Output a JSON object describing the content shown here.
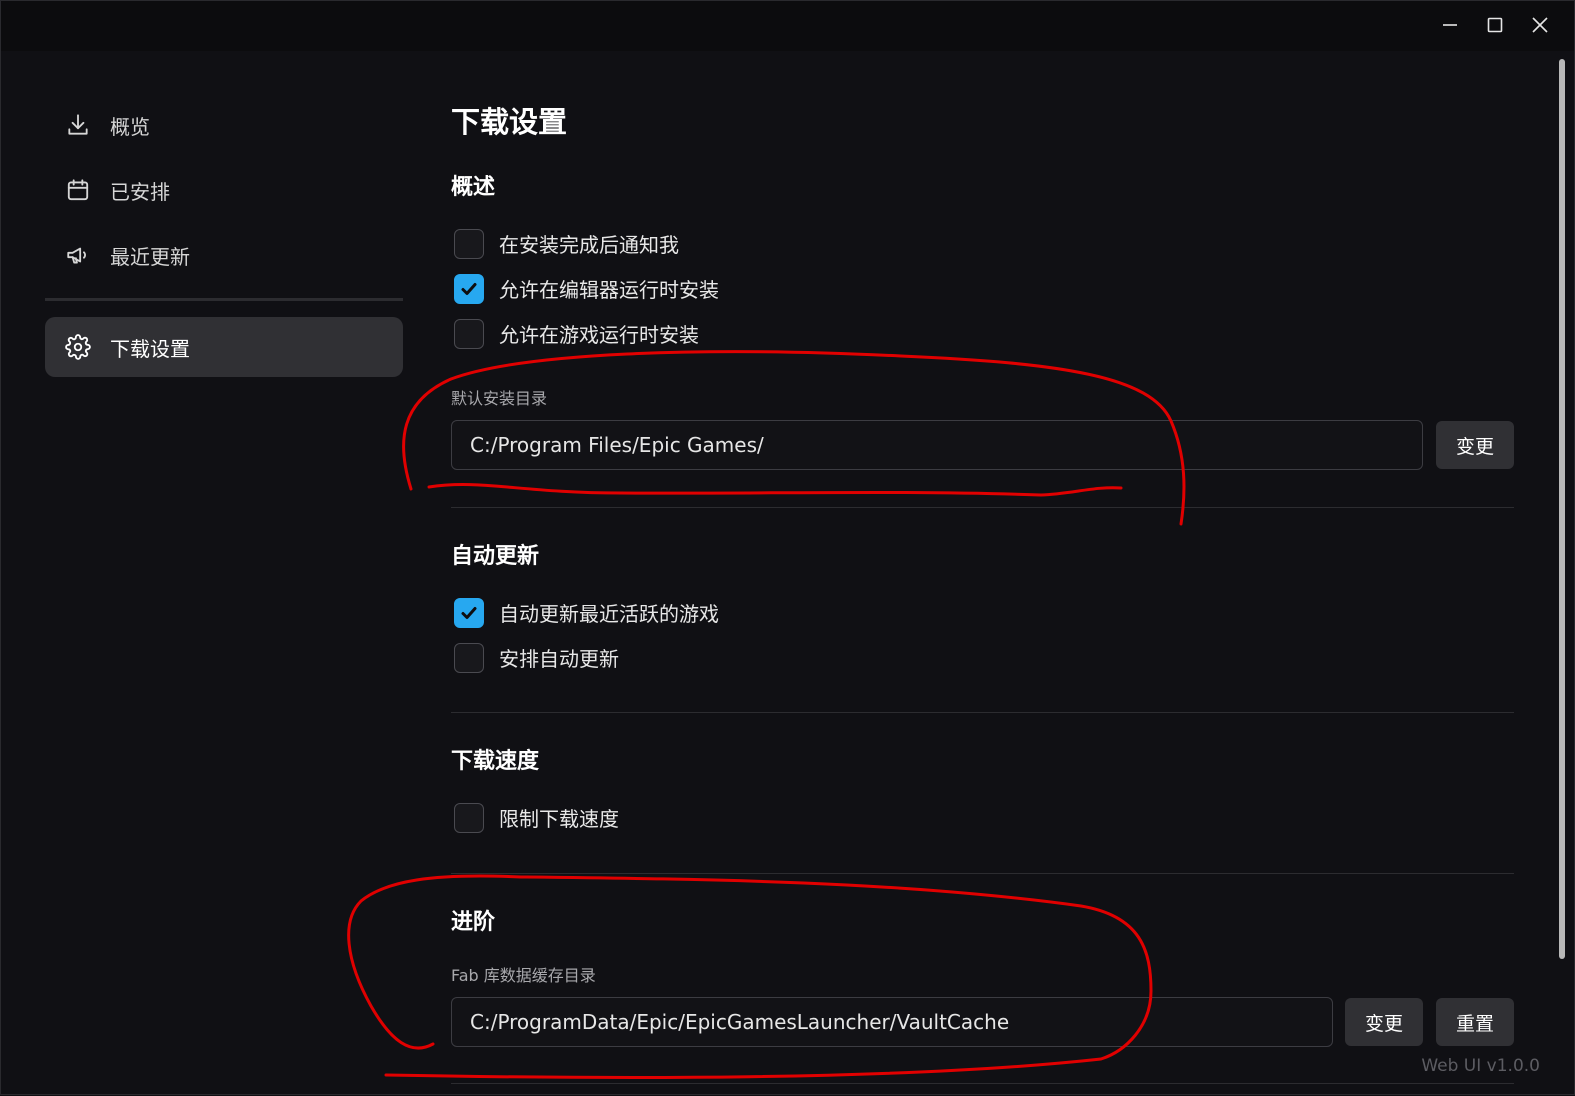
{
  "window": {
    "controls": [
      "minimize",
      "maximize",
      "close"
    ]
  },
  "sidebar": {
    "items": [
      {
        "label": "概览",
        "icon": "download-icon",
        "active": false
      },
      {
        "label": "已安排",
        "icon": "calendar-icon",
        "active": false
      },
      {
        "label": "最近更新",
        "icon": "megaphone-icon",
        "active": false
      },
      {
        "label": "下载设置",
        "icon": "gear-icon",
        "active": true
      }
    ]
  },
  "main": {
    "title": "下载设置",
    "overview": {
      "title": "概述",
      "options": [
        {
          "label": "在安装完成后通知我",
          "checked": false
        },
        {
          "label": "允许在编辑器运行时安装",
          "checked": true
        },
        {
          "label": "允许在游戏运行时安装",
          "checked": false
        }
      ],
      "install_dir_label": "默认安装目录",
      "install_dir_value": "C:/Program Files/Epic Games/",
      "change_button": "变更"
    },
    "auto_update": {
      "title": "自动更新",
      "options": [
        {
          "label": "自动更新最近活跃的游戏",
          "checked": true
        },
        {
          "label": "安排自动更新",
          "checked": false
        }
      ]
    },
    "download_speed": {
      "title": "下载速度",
      "options": [
        {
          "label": "限制下载速度",
          "checked": false
        }
      ]
    },
    "advanced": {
      "title": "进阶",
      "cache_dir_label": "Fab 库数据缓存目录",
      "cache_dir_value": "C:/ProgramData/Epic/EpicGamesLauncher/VaultCache",
      "change_button": "变更",
      "reset_button": "重置"
    }
  },
  "footer": {
    "version": "Web UI v1.0.0"
  },
  "colors": {
    "background": "#101014",
    "accent": "#27a8f0",
    "button": "#303034",
    "annotation": "#e00000"
  }
}
